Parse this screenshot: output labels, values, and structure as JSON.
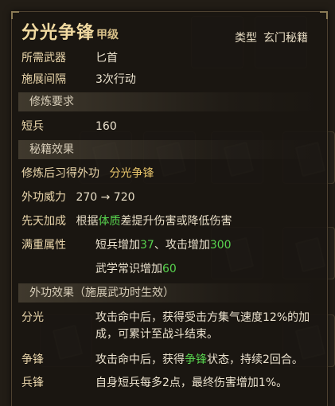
{
  "title": "分光争锋",
  "grade": "甲级",
  "type_key": "类型",
  "type_value": "玄门秘籍",
  "basic": [
    {
      "label": "所需武器",
      "value": "匕首"
    },
    {
      "label": "施展间隔",
      "value": "3次行动"
    }
  ],
  "section_requirements": "修炼要求",
  "requirement": {
    "label": "短兵",
    "value": "160"
  },
  "section_effects": "秘籍效果",
  "learn": {
    "label": "修炼后习得外功",
    "value": "分光争锋"
  },
  "power": {
    "label": "外功威力",
    "value": "270 → 720"
  },
  "innate": {
    "label": "先天加成",
    "pre": "根据",
    "highlight": "体质",
    "post": "差提升伤害或降低伤害"
  },
  "maxed": {
    "label": "满重属性",
    "line1_pre": "短兵增加",
    "line1_val1": "37",
    "line1_mid": "、攻击增加",
    "line1_val2": "300",
    "line2_pre": "武学常识增加",
    "line2_val": "60"
  },
  "section_external": "外功效果（施展武功时生效）",
  "effects": [
    {
      "name": "分光",
      "line1": "攻击命中后，获得受击方集气速度12%的加",
      "line2": "成，可累计至战斗结束。"
    },
    {
      "name": "争锋",
      "pre": "攻击命中后，获得",
      "highlight": "争锋",
      "post": "状态，持续2回合。"
    },
    {
      "name": "兵锋",
      "text": "自身短兵每多2点，最终伤害增加1%。"
    }
  ]
}
